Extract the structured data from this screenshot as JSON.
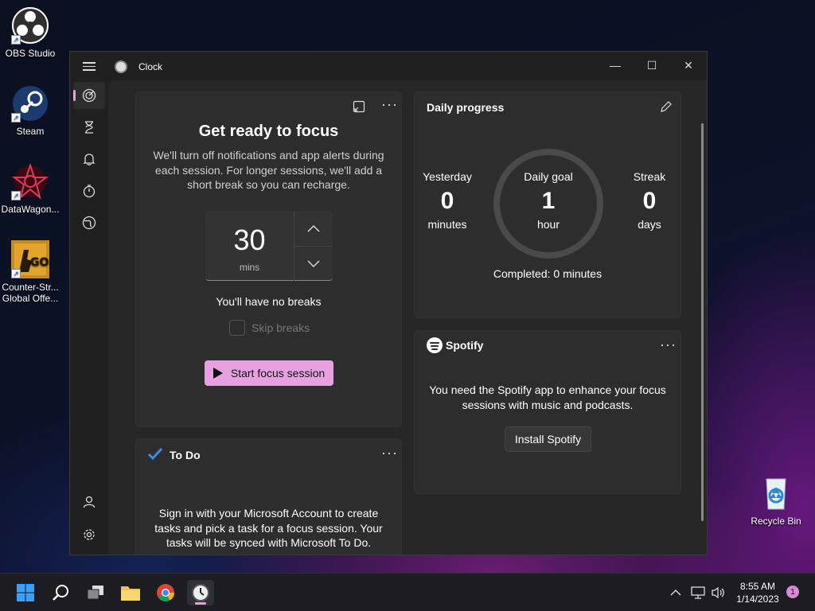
{
  "desktop": {
    "icons": [
      {
        "label": "OBS Studio"
      },
      {
        "label": "Steam"
      },
      {
        "label": "DataWagon..."
      },
      {
        "label": "Counter-Str... Global Offe..."
      },
      {
        "label": "Recycle Bin"
      }
    ]
  },
  "window": {
    "title": "Clock",
    "controls": {
      "minimize": "—",
      "maximize": "☐",
      "close": "✕"
    }
  },
  "nav": {
    "items": [
      {
        "name": "focus-sessions",
        "icon": "focus-icon",
        "active": true
      },
      {
        "name": "timer",
        "icon": "hourglass-icon"
      },
      {
        "name": "alarm",
        "icon": "bell-icon"
      },
      {
        "name": "stopwatch",
        "icon": "stopwatch-icon"
      },
      {
        "name": "world-clock",
        "icon": "globe-icon"
      }
    ],
    "bottom": [
      {
        "name": "account",
        "icon": "person-icon"
      },
      {
        "name": "settings",
        "icon": "gear-icon"
      }
    ]
  },
  "focus": {
    "title": "Get ready to focus",
    "description": "We'll turn off notifications and app alerts during each session. For longer sessions, we'll add a short break so you can recharge.",
    "minutes": "30",
    "unit": "mins",
    "breaks_text": "You'll have no breaks",
    "skip_label": "Skip breaks",
    "start_label": "Start focus session"
  },
  "progress": {
    "title": "Daily progress",
    "yesterday": {
      "label": "Yesterday",
      "value": "0",
      "unit": "minutes"
    },
    "goal": {
      "label": "Daily goal",
      "value": "1",
      "unit": "hour"
    },
    "streak": {
      "label": "Streak",
      "value": "0",
      "unit": "days"
    },
    "completed": "Completed: 0 minutes",
    "completed_fraction": 0
  },
  "spotify": {
    "brand": "Spotify",
    "message": "You need the Spotify app to enhance your focus sessions with music and podcasts.",
    "install_label": "Install Spotify"
  },
  "todo": {
    "title": "To Do",
    "message": "Sign in with your Microsoft Account to create tasks and pick a task for a focus session. Your tasks will be synced with Microsoft To Do."
  },
  "taskbar": {
    "time": "8:55 AM",
    "date": "1/14/2023",
    "notifications": "1"
  },
  "colors": {
    "accent": "#e7a1e0",
    "card": "#2d2d2d",
    "window": "#202020"
  }
}
